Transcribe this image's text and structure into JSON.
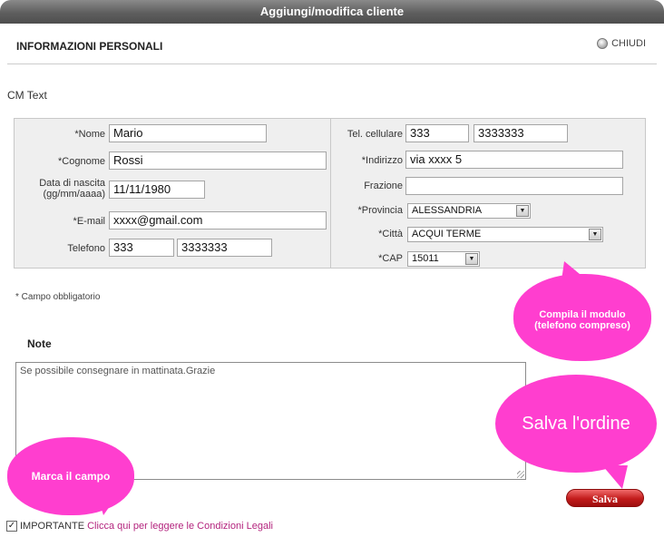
{
  "window": {
    "title": "Aggiungi/modifica cliente"
  },
  "header": {
    "section_title": "INFORMAZIONI PERSONALI",
    "close_label": "CHIUDI"
  },
  "cm_text": "CM Text",
  "form": {
    "left": {
      "nome": {
        "label": "*Nome",
        "value": "Mario"
      },
      "cognome": {
        "label": "*Cognome",
        "value": "Rossi"
      },
      "data_nascita": {
        "label_line1": "Data di nascita",
        "label_line2": "(gg/mm/aaaa)",
        "value": "11/11/1980"
      },
      "email": {
        "label": "*E-mail",
        "value": "xxxx@gmail.com"
      },
      "telefono": {
        "label": "Telefono",
        "prefix": "333",
        "number": "3333333"
      }
    },
    "right": {
      "cellulare": {
        "label": "Tel. cellulare",
        "prefix": "333",
        "number": "3333333"
      },
      "indirizzo": {
        "label": "*Indirizzo",
        "value": "via xxxx 5"
      },
      "frazione": {
        "label": "Frazione",
        "value": ""
      },
      "provincia": {
        "label": "*Provincia",
        "value": "ALESSANDRIA"
      },
      "citta": {
        "label": "*Città",
        "value": "ACQUI TERME"
      },
      "cap": {
        "label": "*CAP",
        "value": "15011"
      }
    }
  },
  "required_note": "* Campo obbligatorio",
  "notes": {
    "title": "Note",
    "value": "Se possibile consegnare in mattinata.Grazie"
  },
  "bubbles": {
    "compila_line1": "Compila il modulo",
    "compila_line2": "(telefono compreso)",
    "salva": "Salva l'ordine",
    "marca": "Marca il campo"
  },
  "save_button": "Salva",
  "agreement": {
    "checked_mark": "✓",
    "label": "IMPORTANTE",
    "link": "Clicca qui per leggere le Condizioni Legali"
  },
  "colors": {
    "bubble": "#ff3ecf",
    "save_button": "#c21b1b",
    "link": "#b3237d"
  }
}
